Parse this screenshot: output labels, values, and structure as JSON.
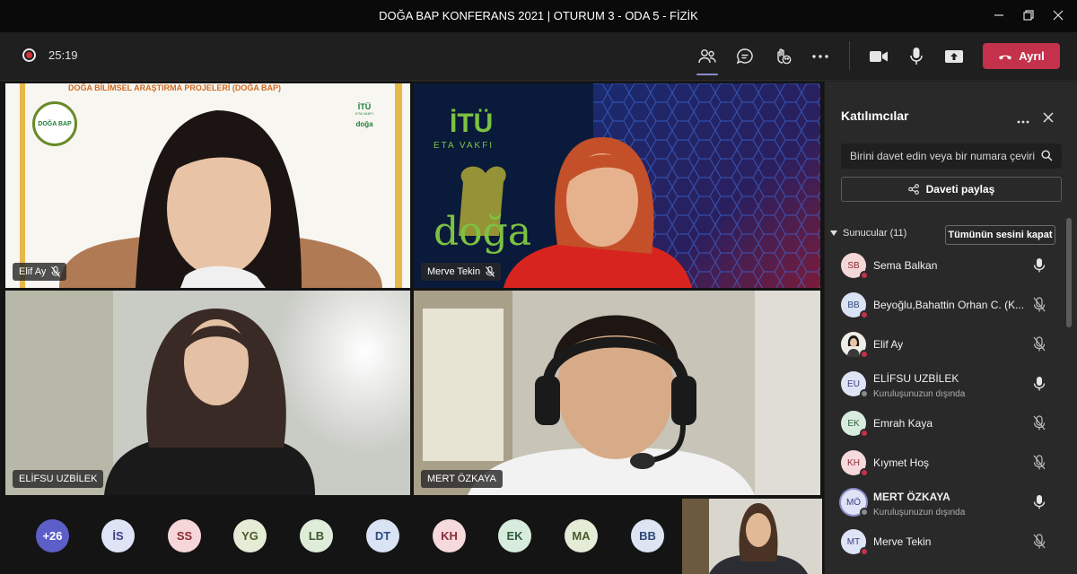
{
  "window": {
    "title": "DOĞA BAP KONFERANS 2021 | OTURUM 3 - ODA 5 - FİZİK"
  },
  "toolbar": {
    "timer": "25:19",
    "leave_label": "Ayrıl"
  },
  "tiles": [
    {
      "name": "Elif Ay"
    },
    {
      "name": "Merve Tekin"
    },
    {
      "name": "ELİFSU UZBİLEK"
    },
    {
      "name": "MERT ÖZKAYA"
    }
  ],
  "tile_text": {
    "itu": "İTÜ",
    "eta": "ETA VAKFI",
    "doga": "doğa",
    "banner": "DOĞA BİLİMSEL ARAŞTIRMA PROJELERİ (DOĞA BAP)",
    "logo_badge": "DOĞA BAP",
    "logo_itu": "İTÜ",
    "logo_sub": "ETA VAKFI",
    "logo_doga": "doğa"
  },
  "avatar_row": [
    {
      "initials": "+26",
      "bg": "#5b5fc7",
      "fg": "#ffffff"
    },
    {
      "initials": "İS",
      "bg": "#dfe3f6",
      "fg": "#3b3f80"
    },
    {
      "initials": "SS",
      "bg": "#f6d6d9",
      "fg": "#8a2a35"
    },
    {
      "initials": "YG",
      "bg": "#e5ecd6",
      "fg": "#4b5a25"
    },
    {
      "initials": "LB",
      "bg": "#dfecd9",
      "fg": "#3c5a30"
    },
    {
      "initials": "DT",
      "bg": "#d9e3f3",
      "fg": "#2f4a80"
    },
    {
      "initials": "KH",
      "bg": "#f6d9dc",
      "fg": "#8a2d3a"
    },
    {
      "initials": "EK",
      "bg": "#d8ecdd",
      "fg": "#2f5e3b"
    },
    {
      "initials": "MA",
      "bg": "#e4ecd8",
      "fg": "#4a5b2b"
    },
    {
      "initials": "BB",
      "bg": "#dde5f2",
      "fg": "#2f4678"
    }
  ],
  "panel": {
    "title": "Katılımcılar",
    "invite_placeholder": "Birini davet edin veya bir numara çevirin",
    "share_label": "Daveti paylaş",
    "section_label": "Sunucular (11)",
    "mute_all_label": "Tümünün sesini kapat",
    "participants": [
      {
        "initials": "SB",
        "name": "Sema Balkan",
        "sub": "",
        "bg": "#f4d8d8",
        "fg": "#8a2a2a",
        "status": "#c4314b",
        "mic": "on",
        "bold": false
      },
      {
        "initials": "BB",
        "name": "Beyoğlu,Bahattin Orhan C. (K...",
        "sub": "",
        "bg": "#d9e3f3",
        "fg": "#2f4a80",
        "status": "#c4314b",
        "mic": "off",
        "bold": false
      },
      {
        "initials": "",
        "name": "Elif Ay",
        "sub": "",
        "bg": "#2b2b2b",
        "fg": "#ffffff",
        "status": "#c4314b",
        "mic": "off",
        "bold": false
      },
      {
        "initials": "EU",
        "name": "ELİFSU UZBİLEK",
        "sub": "Kuruluşunuzun dışında",
        "bg": "#dfe3f6",
        "fg": "#3b3f80",
        "status": "#8a8a8a",
        "mic": "on",
        "bold": false
      },
      {
        "initials": "EK",
        "name": "Emrah Kaya",
        "sub": "",
        "bg": "#d8ecdd",
        "fg": "#2f5e3b",
        "status": "#c4314b",
        "mic": "off",
        "bold": false
      },
      {
        "initials": "KH",
        "name": "Kıymet Hoş",
        "sub": "",
        "bg": "#f6d9dc",
        "fg": "#8a2d3a",
        "status": "#c4314b",
        "mic": "off",
        "bold": false
      },
      {
        "initials": "MÖ",
        "name": "MERT ÖZKAYA",
        "sub": "Kuruluşunuzun dışında",
        "bg": "#dfe3f6",
        "fg": "#3b3f80",
        "status": "#8a8a8a",
        "mic": "on",
        "bold": true
      },
      {
        "initials": "MT",
        "name": "Merve Tekin",
        "sub": "",
        "bg": "#dfe3f6",
        "fg": "#3b3f80",
        "status": "#c4314b",
        "mic": "off",
        "bold": false
      }
    ]
  }
}
